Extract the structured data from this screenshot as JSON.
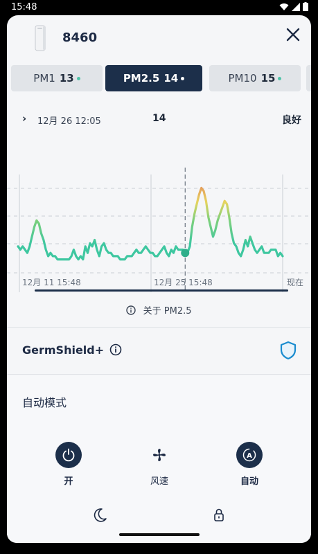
{
  "status_bar": {
    "time": "15:48"
  },
  "device": {
    "name": "8460"
  },
  "pm_tabs": [
    {
      "label": "PM1",
      "value": "13"
    },
    {
      "label": "PM2.5",
      "value": "14"
    },
    {
      "label": "PM10",
      "value": "15"
    }
  ],
  "chart_info": {
    "date": "12月 26 12:05",
    "value": "14",
    "quality": "良好"
  },
  "chart_data": {
    "type": "line",
    "x_labels": [
      "12月 11 15:48",
      "12月 25 15:48",
      "现在"
    ],
    "values": [
      6,
      5,
      6,
      5,
      4,
      6,
      9,
      12,
      14,
      13,
      10,
      8,
      5,
      3,
      4,
      3,
      3,
      2,
      2,
      2,
      2,
      2,
      2,
      3,
      5,
      3,
      2,
      3,
      2,
      6,
      4,
      7,
      6,
      8,
      5,
      3,
      6,
      7,
      5,
      4,
      4,
      3,
      3,
      3,
      2,
      2,
      2,
      3,
      3,
      3,
      4,
      5,
      4,
      4,
      5,
      6,
      5,
      4,
      4,
      3,
      3,
      4,
      5,
      6,
      4,
      3,
      5,
      4,
      6,
      5,
      5,
      5,
      4,
      4,
      6,
      12,
      16,
      19,
      22,
      24,
      23,
      20,
      15,
      12,
      9,
      11,
      14,
      16,
      18,
      20,
      19,
      15,
      10,
      7,
      6,
      4,
      3,
      5,
      8,
      6,
      9,
      7,
      5,
      4,
      5,
      6,
      4,
      4,
      4,
      5,
      5,
      5,
      3,
      4,
      3
    ],
    "marker_index": 72
  },
  "about": {
    "label": "关于 PM2.5"
  },
  "germshield": {
    "title": "GermShield+"
  },
  "mode": {
    "label": "自动模式"
  },
  "controls": [
    {
      "label": "开"
    },
    {
      "label": "风速"
    },
    {
      "label": "自动"
    }
  ],
  "colors": {
    "accent": "#1c2f4a",
    "shield": "#1a8ccf",
    "good": "#3ec7a0",
    "bad": "#e4725a"
  }
}
